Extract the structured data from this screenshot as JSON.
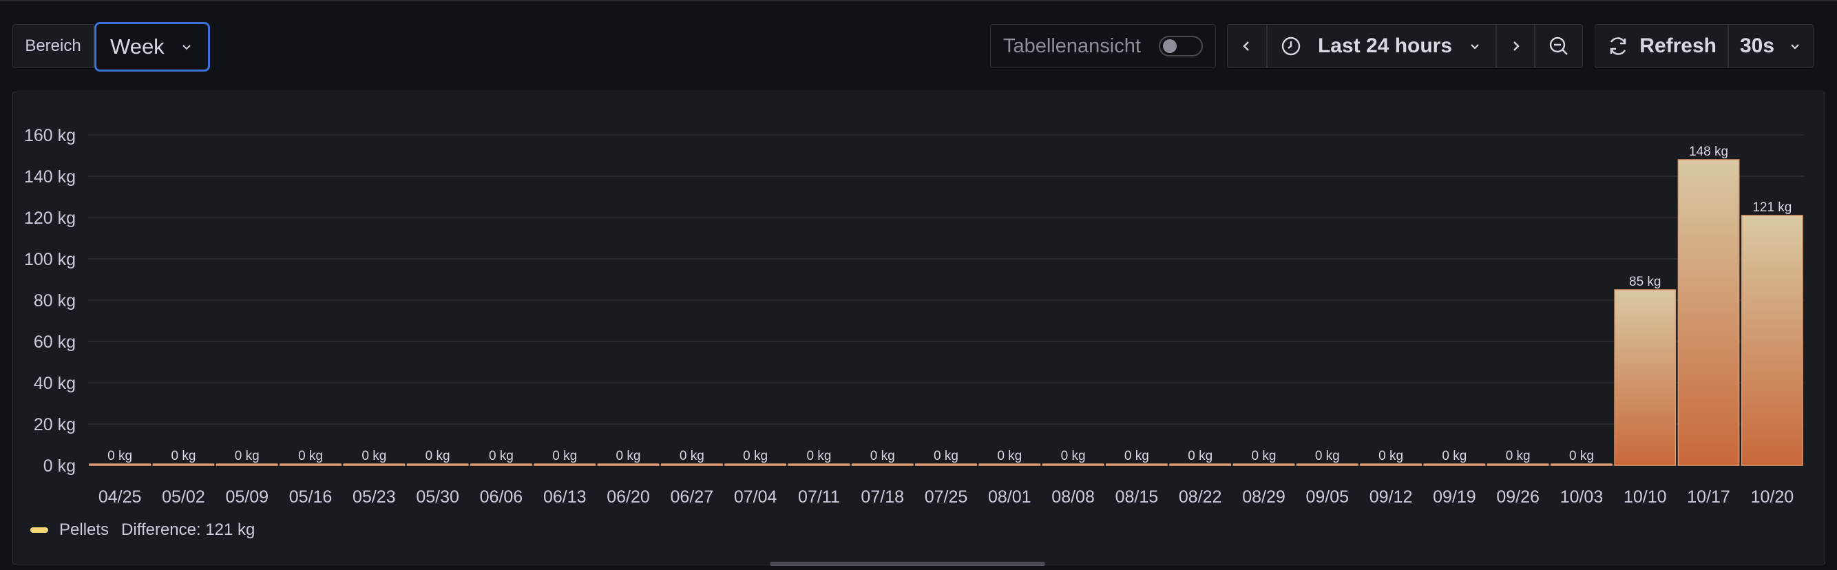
{
  "toolbar": {
    "range_label": "Bereich",
    "range_value": "Week",
    "table_view_label": "Tabellenansicht",
    "time_range": "Last 24 hours",
    "refresh_label": "Refresh",
    "refresh_interval": "30s"
  },
  "legend": {
    "series_name": "Pellets",
    "calc": "Difference: 121 kg"
  },
  "colors": {
    "accent": "#3d71d9",
    "bar_top": "#d8c7a1",
    "bar_bottom": "#c8683a",
    "legend": "#f5d77a"
  },
  "chart_data": {
    "type": "bar",
    "categories": [
      "04/25",
      "05/02",
      "05/09",
      "05/16",
      "05/23",
      "05/30",
      "06/06",
      "06/13",
      "06/20",
      "06/27",
      "07/04",
      "07/11",
      "07/18",
      "07/25",
      "08/01",
      "08/08",
      "08/15",
      "08/22",
      "08/29",
      "09/05",
      "09/12",
      "09/19",
      "09/26",
      "10/03",
      "10/10",
      "10/17",
      "10/20"
    ],
    "series": [
      {
        "name": "Pellets",
        "values": [
          0,
          0,
          0,
          0,
          0,
          0,
          0,
          0,
          0,
          0,
          0,
          0,
          0,
          0,
          0,
          0,
          0,
          0,
          0,
          0,
          0,
          0,
          0,
          0,
          85,
          148,
          121
        ]
      }
    ],
    "data_labels": [
      "0 kg",
      "0 kg",
      "0 kg",
      "0 kg",
      "0 kg",
      "0 kg",
      "0 kg",
      "0 kg",
      "0 kg",
      "0 kg",
      "0 kg",
      "0 kg",
      "0 kg",
      "0 kg",
      "0 kg",
      "0 kg",
      "0 kg",
      "0 kg",
      "0 kg",
      "0 kg",
      "0 kg",
      "0 kg",
      "0 kg",
      "0 kg",
      "85 kg",
      "148 kg",
      "121 kg"
    ],
    "y_ticks": [
      "0 kg",
      "20 kg",
      "40 kg",
      "60 kg",
      "80 kg",
      "100 kg",
      "120 kg",
      "140 kg",
      "160 kg"
    ],
    "ylim": [
      0,
      160
    ],
    "grid": true,
    "legend_position": "bottom-left"
  }
}
